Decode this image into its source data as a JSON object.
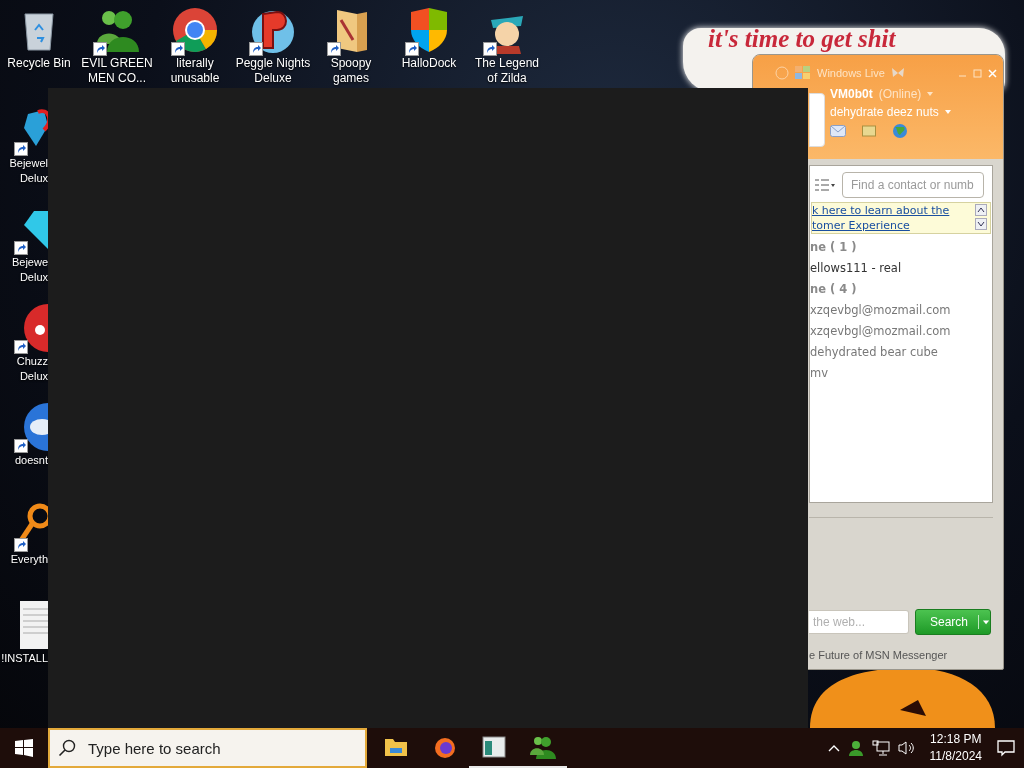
{
  "wallpaper": {
    "caption": "it's time to get shit"
  },
  "desktop_icons": [
    {
      "label": "Recycle Bin",
      "shortcut": false
    },
    {
      "label": "EVIL GREEN\nMEN CO...",
      "shortcut": true
    },
    {
      "label": "literally\nunusable",
      "shortcut": true
    },
    {
      "label": "Peggle Nights\nDeluxe",
      "shortcut": true
    },
    {
      "label": "Spoopy\ngames",
      "shortcut": true
    },
    {
      "label": "HalloDock",
      "shortcut": true
    },
    {
      "label": "The Legend\nof Zilda",
      "shortcut": true
    }
  ],
  "side_icons": [
    {
      "label": "Bejewel\nDelux",
      "shortcut": true
    },
    {
      "label": "Bejewe\nDelux",
      "shortcut": true
    },
    {
      "label": "Chuzz\nDelux",
      "shortcut": true
    },
    {
      "label": "doesnt",
      "shortcut": true
    },
    {
      "label": "Everyth",
      "shortcut": true
    },
    {
      "label": "!INSTALL",
      "shortcut": false
    }
  ],
  "messenger": {
    "title": "Windows Live",
    "name": "VM0b0t",
    "status": "(Online)",
    "personal_message": "dehydrate deez nuts",
    "contact_search": {
      "placeholder": "Find a contact or numb"
    },
    "banner_link": "k here to learn about the\ntomer Experience",
    "groups": [
      {
        "header": "ne ( 1 )",
        "contacts": [
          "ellows111 - real"
        ]
      },
      {
        "header": "ne ( 4 )",
        "contacts": [
          "xzqevbgl@mozmail.com",
          "xzqevbgl@mozmail.com",
          "dehydrated bear cube",
          "mv"
        ]
      }
    ],
    "web_search": {
      "placeholder": "the web...",
      "button": "Search"
    },
    "footer": "e Future of MSN Messenger"
  },
  "taskbar": {
    "search": {
      "placeholder": "Type here to search"
    },
    "apps": [
      {
        "running": false
      },
      {
        "running": false
      },
      {
        "running": true
      },
      {
        "running": true
      }
    ],
    "time": "12:18 PM",
    "date": "11/8/2024"
  }
}
